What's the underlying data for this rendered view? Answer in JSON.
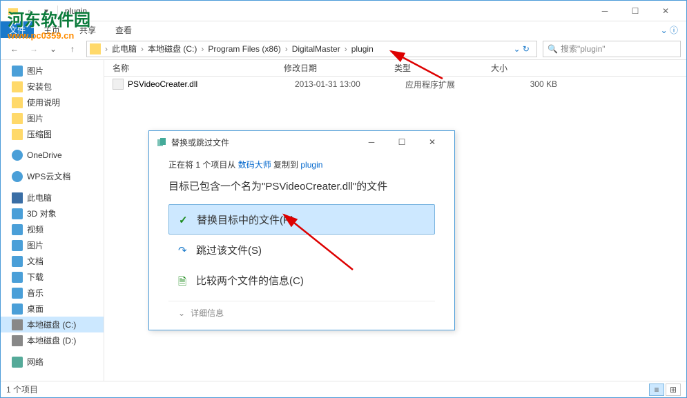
{
  "window": {
    "title": "plugin"
  },
  "watermark": {
    "text": "河东软件园",
    "url": "www.pc0359.cn"
  },
  "ribbon": {
    "file": "文件",
    "home": "主页",
    "share": "共享",
    "view": "查看"
  },
  "breadcrumb": {
    "root": "此电脑",
    "drive": "本地磁盘 (C:)",
    "pf": "Program Files (x86)",
    "dm": "DigitalMaster",
    "plugin": "plugin"
  },
  "search": {
    "placeholder": "搜索\"plugin\""
  },
  "sidebar": {
    "items": [
      {
        "label": "图片",
        "icon": "blue-ico"
      },
      {
        "label": "安装包",
        "icon": "folder-ico"
      },
      {
        "label": "使用说明",
        "icon": "folder-ico"
      },
      {
        "label": "图片",
        "icon": "folder-ico"
      },
      {
        "label": "压缩图",
        "icon": "folder-ico"
      }
    ],
    "onedrive": "OneDrive",
    "wps": "WPS云文档",
    "thispc": "此电脑",
    "pc_items": [
      {
        "label": "3D 对象",
        "icon": "blue-ico"
      },
      {
        "label": "视频",
        "icon": "blue-ico"
      },
      {
        "label": "图片",
        "icon": "blue-ico"
      },
      {
        "label": "文档",
        "icon": "blue-ico"
      },
      {
        "label": "下载",
        "icon": "blue-ico"
      },
      {
        "label": "音乐",
        "icon": "blue-ico"
      },
      {
        "label": "桌面",
        "icon": "blue-ico"
      },
      {
        "label": "本地磁盘 (C:)",
        "icon": "disk-ico"
      },
      {
        "label": "本地磁盘 (D:)",
        "icon": "disk-ico"
      }
    ],
    "network": "网络"
  },
  "columns": {
    "name": "名称",
    "date": "修改日期",
    "type": "类型",
    "size": "大小"
  },
  "files": [
    {
      "name": "PSVideoCreater.dll",
      "date": "2013-01-31 13:00",
      "type": "应用程序扩展",
      "size": "300 KB"
    }
  ],
  "dialog": {
    "title": "替换或跳过文件",
    "copy_prefix": "正在将 1 个项目从 ",
    "copy_src": "数码大师",
    "copy_mid": " 复制到 ",
    "copy_dst": "plugin",
    "conflict": "目标已包含一个名为\"PSVideoCreater.dll\"的文件",
    "opt_replace": "替换目标中的文件(R)",
    "opt_skip": "跳过该文件(S)",
    "opt_compare": "比较两个文件的信息(C)",
    "details": "详细信息"
  },
  "status": {
    "count": "1 个项目"
  }
}
